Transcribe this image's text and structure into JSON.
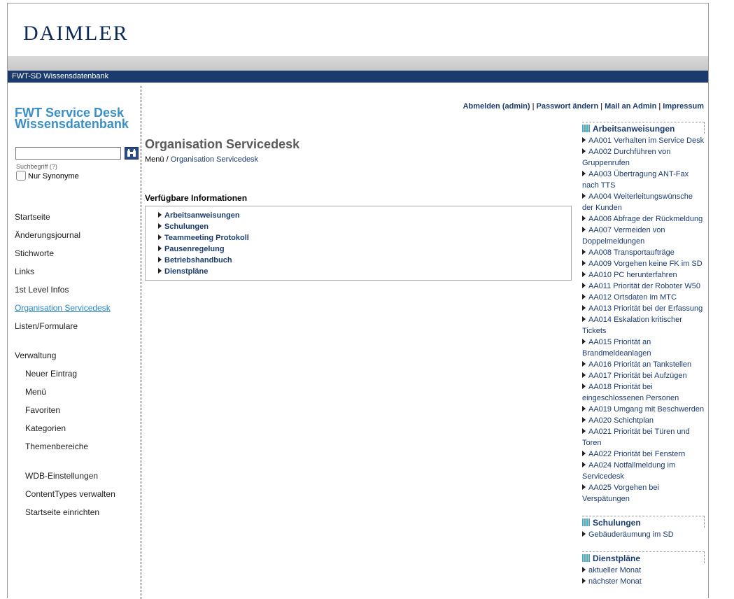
{
  "header": {
    "logo": "DAIMLER",
    "bar_title": "FWT-SD Wissensdatenbank"
  },
  "sidebar": {
    "app_title_line1": "FWT Service Desk",
    "app_title_line2": "Wissensdatenbank",
    "search": {
      "placeholder": "",
      "value": "",
      "hint": "Suchbegriff (?)"
    },
    "synonym_label": "Nur Synonyme",
    "nav": [
      "Startseite",
      "Änderungsjournal",
      "Stichworte",
      "Links",
      "1st Level Infos",
      "Organisation Servicedesk",
      "Listen/Formulare"
    ],
    "admin_heading": "Verwaltung",
    "admin_items": [
      "Neuer Eintrag",
      "Menü",
      "Favoriten",
      "Kategorien",
      "Themenbereiche"
    ],
    "settings_items": [
      "WDB-Einstellungen",
      "ContentTypes verwalten",
      "Startseite einrichten"
    ]
  },
  "top_links": [
    "Abmelden (admin)",
    "Passwort ändern",
    "Mail an Admin",
    "Impressum"
  ],
  "main": {
    "title": "Organisation Servicedesk",
    "breadcrumb_root": "Menü",
    "breadcrumb_sep": "/",
    "breadcrumb_current": "Organisation Servicedesk",
    "section_title": "Verfügbare Informationen",
    "items": [
      "Arbeitsanweisungen",
      "Schulungen",
      "Teammeeting Protokoll",
      "Pausenregelung",
      "Betriebshandbuch",
      "Dienstpläne"
    ]
  },
  "right": {
    "arbeitsanweisungen_title": "Arbeitsanweisungen",
    "arbeitsanweisungen": [
      "AA001 Verhalten im Service Desk",
      "AA002 Durchführen von Gruppenrufen",
      "AA003 Übertragung ANT-Fax nach TTS",
      "AA004 Weiterleitungswünsche der Kunden",
      "AA006 Abfrage der Rückmeldung",
      "AA007 Vermeiden von Doppelmeldungen",
      "AA008 Transportaufträge",
      "AA009 Vorgehen keine FK im SD",
      "AA010 PC herunterfahren",
      "AA011 Priorität der Roboter W50",
      "AA012 Ortsdaten im MTC",
      "AA013 Priorität bei der Erfassung",
      "AA014 Eskalation kritischer Tickets",
      "AA015 Priorität an Brandmeldeanlagen",
      "AA016 Priorität an Tankstellen",
      "AA017 Priorität bei Aufzügen",
      "AA018 Priorität bei eingeschlossenen Personen",
      "AA019 Umgang mit Beschwerden",
      "AA020 Schichtplan",
      "AA021 Priorität bei Türen und Toren",
      "AA022 Priorität bei Fenstern",
      "AA024 Notfallmeldung im Servicedesk",
      "AA025 Vorgehen bei Verspätungen"
    ],
    "schulungen_title": "Schulungen",
    "schulungen": [
      "Gebäuderäumung im SD"
    ],
    "dienstplaene_title": "Dienstpläne",
    "dienstplaene": [
      "aktueller Monat",
      "nächster Monat"
    ]
  }
}
